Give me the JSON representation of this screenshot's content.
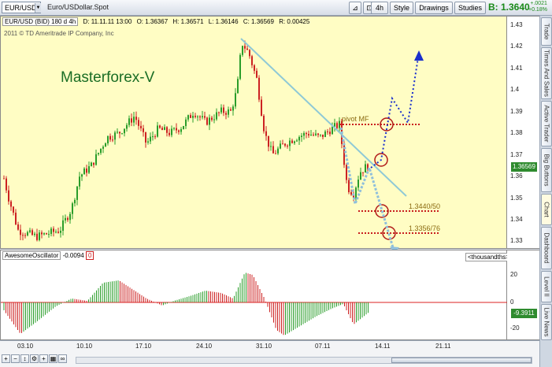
{
  "toolbar": {
    "symbol": "EUR/USD",
    "description": "Euro/USDollar.Spot",
    "interval": "4h",
    "style_label": "Style",
    "drawings_label": "Drawings",
    "studies_label": "Studies",
    "bid_price": "B: 1.3640",
    "change_abs": "+.0021",
    "change_pct": "+0.18%"
  },
  "sidebar": {
    "tabs": [
      "Trade",
      "Times And Sales",
      "Active Trader",
      "Big Buttons",
      "Chart",
      "Dashboard",
      "Level II",
      "Live News"
    ],
    "active": "Chart"
  },
  "main_chart": {
    "info": {
      "symbol": "EUR/USD (BID) 180 d 4h",
      "date": "D: 11.11.11 13:00",
      "open": "O: 1.36367",
      "high": "H: 1.36571",
      "low": "L: 1.36146",
      "close": "C: 1.36569",
      "range": "R: 0.00425"
    },
    "copyright": "2011 © TD Ameritrade IP Company, Inc",
    "brand_text": "Masterforex-V",
    "annotations": {
      "pivot_label": "pivot MF",
      "level1_label": "1.3440/50",
      "level2_label": "1.3356/76"
    },
    "y_ticks": [
      "1.43",
      "1.42",
      "1.41",
      "1.4",
      "1.39",
      "1.38",
      "1.37",
      "1.36",
      "1.35",
      "1.34",
      "1.33"
    ],
    "last_price_tag": "1.36569"
  },
  "oscillator": {
    "name": "AwesomeOscillator",
    "value": "-0.0094",
    "zero_badge": "0",
    "units": "<thousandths>",
    "y_ticks": [
      "20",
      "0",
      "-20"
    ],
    "last_value_tag": "-9.3911"
  },
  "x_ticks": [
    "03.10",
    "10.10",
    "17.10",
    "24.10",
    "31.10",
    "07.11",
    "14.11",
    "21.11"
  ],
  "colors": {
    "up_bar": "#2a9d2a",
    "down_bar": "#cc2222",
    "plot_bg": "#fffdc4",
    "trendline": "#8fc9d6",
    "forecast_arrow": "#1a2fcc"
  },
  "chart_data": {
    "type": "candlestick",
    "x": [
      "03.10",
      "10.10",
      "17.10",
      "24.10",
      "31.10",
      "07.11",
      "11.11"
    ],
    "series": [
      {
        "name": "EUR/USD",
        "values": [
          1.335,
          1.37,
          1.385,
          1.39,
          1.42,
          1.38,
          1.3657
        ]
      },
      {
        "name": "AwesomeOscillator",
        "values": [
          -20,
          5,
          12,
          5,
          20,
          -25,
          -9.39
        ]
      }
    ],
    "ylim": [
      1.325,
      1.435
    ]
  }
}
